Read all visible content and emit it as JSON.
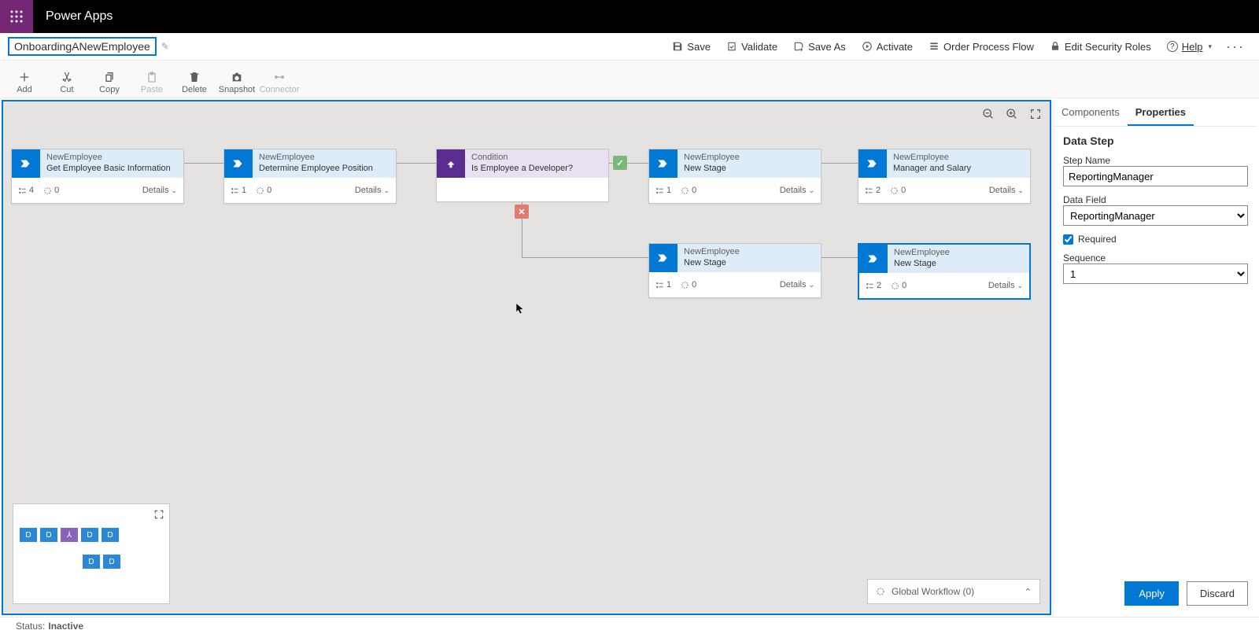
{
  "header": {
    "app_name": "Power Apps",
    "flow_name": "OnboardingANewEmployee"
  },
  "commands": {
    "save": "Save",
    "validate": "Validate",
    "save_as": "Save As",
    "activate": "Activate",
    "order": "Order Process Flow",
    "edit_sec": "Edit Security Roles",
    "help": "Help"
  },
  "toolbar": {
    "add": "Add",
    "cut": "Cut",
    "copy": "Copy",
    "paste": "Paste",
    "delete": "Delete",
    "snapshot": "Snapshot",
    "connector": "Connector"
  },
  "stages": [
    {
      "entity": "NewEmployee",
      "name": "Get Employee Basic Information",
      "steps": "4",
      "triggers": "0",
      "details": "Details"
    },
    {
      "entity": "NewEmployee",
      "name": "Determine Employee Position",
      "steps": "1",
      "triggers": "0",
      "details": "Details"
    },
    {
      "entity": "Condition",
      "name": "Is Employee a Developer?",
      "is_condition": true
    },
    {
      "entity": "NewEmployee",
      "name": "New Stage",
      "steps": "1",
      "triggers": "0",
      "details": "Details"
    },
    {
      "entity": "NewEmployee",
      "name": "Manager and Salary",
      "steps": "2",
      "triggers": "0",
      "details": "Details"
    },
    {
      "entity": "NewEmployee",
      "name": "New Stage",
      "steps": "1",
      "triggers": "0",
      "details": "Details"
    },
    {
      "entity": "NewEmployee",
      "name": "New Stage",
      "steps": "2",
      "triggers": "0",
      "details": "Details"
    }
  ],
  "global_workflow": {
    "label": "Global Workflow (0)"
  },
  "props": {
    "tab_components": "Components",
    "tab_properties": "Properties",
    "section_title": "Data Step",
    "step_name_label": "Step Name",
    "step_name_value": "ReportingManager",
    "data_field_label": "Data Field",
    "data_field_value": "ReportingManager",
    "required_label": "Required",
    "sequence_label": "Sequence",
    "sequence_value": "1",
    "apply": "Apply",
    "discard": "Discard"
  },
  "status": {
    "label": "Status:",
    "value": "Inactive"
  }
}
